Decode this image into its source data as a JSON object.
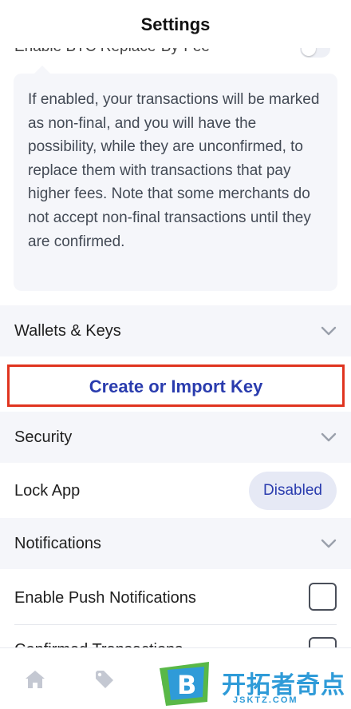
{
  "header": {
    "title": "Settings"
  },
  "rbf": {
    "label": "Enable BTC Replace-By-Fee",
    "enabled": false
  },
  "info": {
    "text": "If enabled, your transactions will be marked as non-final, and you will have the possibility, while they are unconfirmed, to replace them with transactions that pay higher fees. Note that some merchants do not accept non-final transactions until they are confirmed."
  },
  "sections": {
    "wallets": {
      "label": "Wallets & Keys"
    },
    "create": {
      "label": "Create or Import Key"
    },
    "security": {
      "label": "Security"
    },
    "lock_app": {
      "label": "Lock App",
      "value": "Disabled"
    },
    "notifications": {
      "label": "Notifications"
    },
    "push": {
      "label": "Enable Push Notifications",
      "checked": false
    },
    "confirmed": {
      "label": "Confirmed Transactions",
      "checked": false
    }
  },
  "nav": {
    "icons": [
      "home-icon",
      "tag-icon",
      "wallet-icon"
    ]
  },
  "watermark": {
    "title": "开拓者奇点",
    "sub": "JSKTZ.COM",
    "logo_letter": "B"
  },
  "colors": {
    "accent": "#2a3cae",
    "highlight": "#e0341f",
    "section_bg": "#f5f6fa",
    "watermark": "#2f9bd8"
  }
}
